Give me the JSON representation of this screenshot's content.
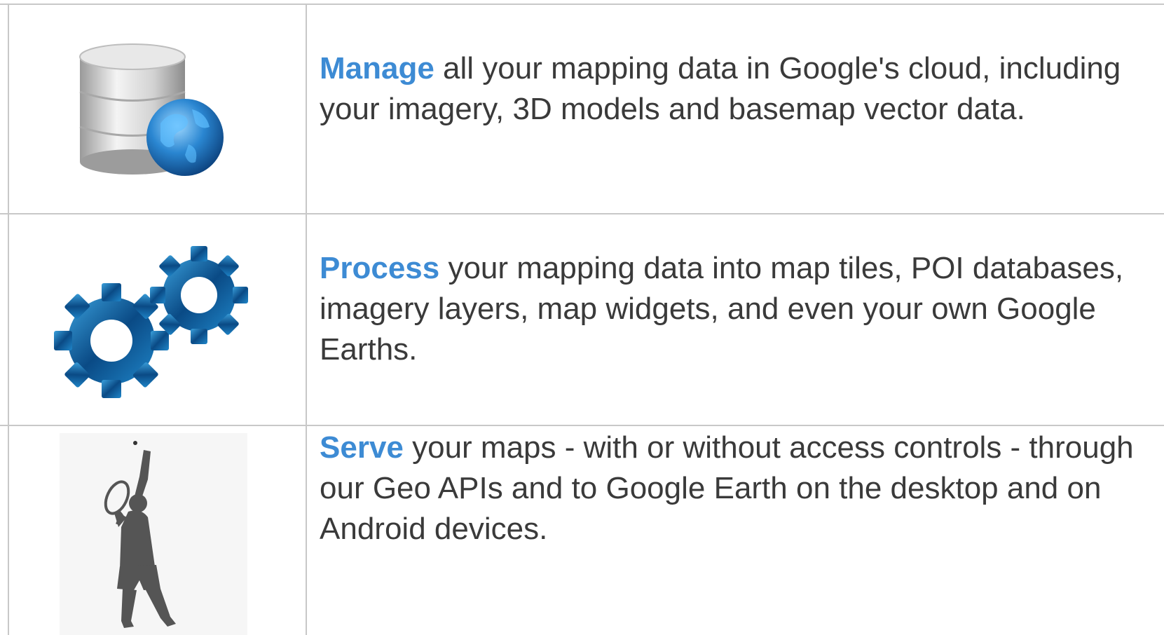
{
  "rows": [
    {
      "keyword": "Manage",
      "text": " all your mapping data in Google's cloud, including your imagery, 3D models and basemap vector data.",
      "icon": "database-globe-icon"
    },
    {
      "keyword": "Process",
      "text": " your mapping data into map tiles, POI databases, imagery layers, map widgets, and even your own Google Earths.",
      "icon": "gears-icon"
    },
    {
      "keyword": "Serve",
      "text": " your maps - with or without access controls - through our Geo APIs and to Google Earth on the desktop and on Android devices.",
      "icon": "tennis-serve-icon"
    }
  ],
  "colors": {
    "keyword": "#3d8bd4",
    "text": "#3a3a3a",
    "border": "#c8c8c8"
  }
}
